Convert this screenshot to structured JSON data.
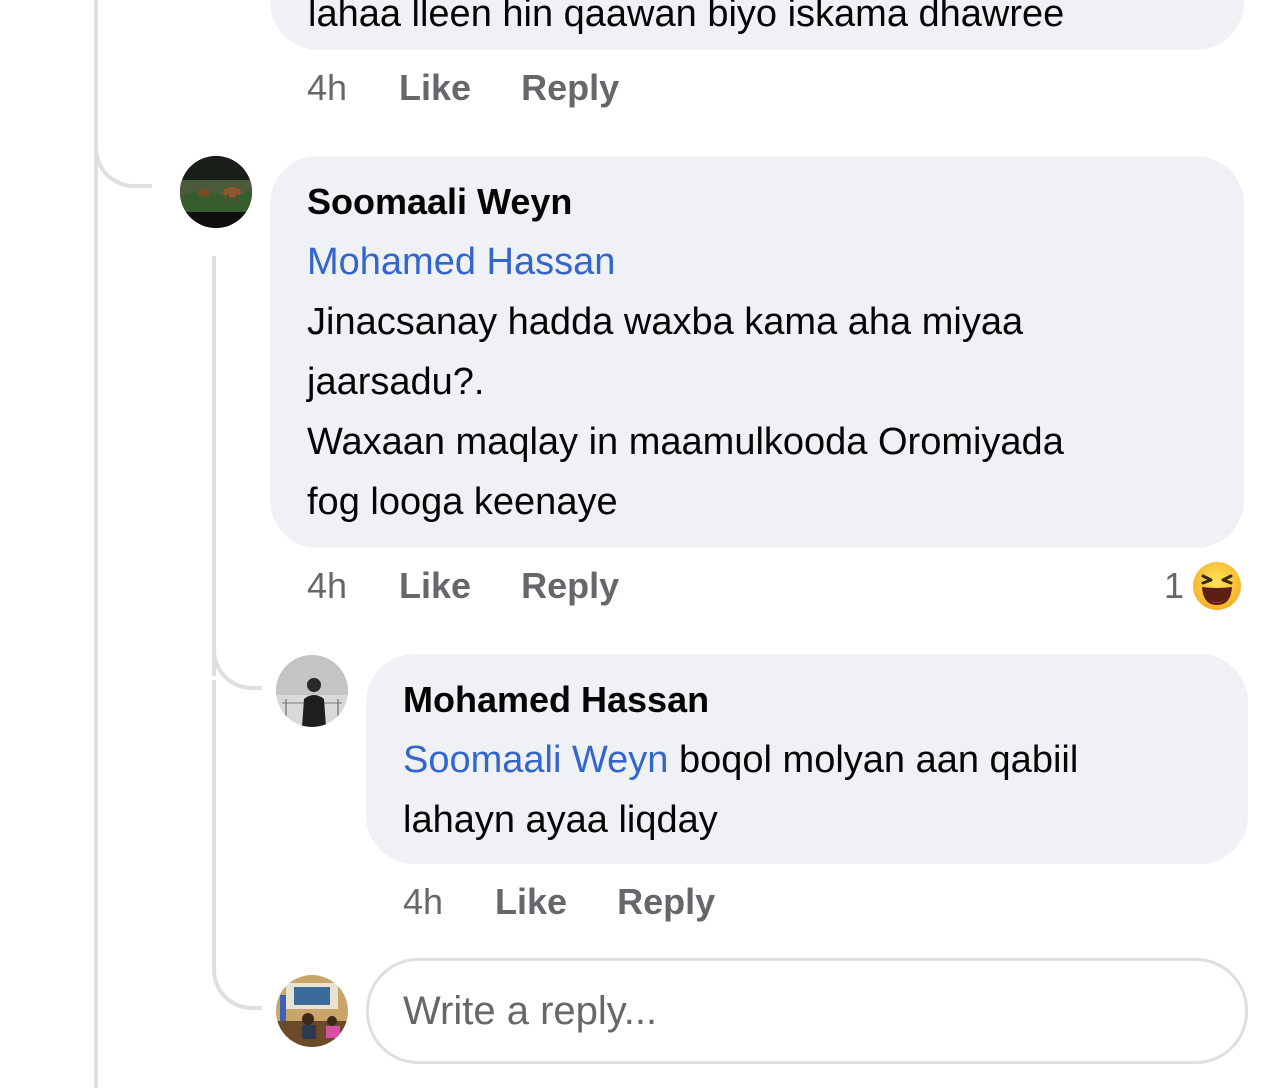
{
  "top_comment": {
    "text_tail": "lahaa lleen hin qaawan biyo iskama dhawree",
    "time": "4h",
    "like": "Like",
    "reply": "Reply"
  },
  "comment": {
    "author": "Soomaali Weyn",
    "mention": "Mohamed Hassan",
    "text_line1": "Jinacsanay hadda waxba kama aha miyaa",
    "text_line2": "jaarsadu?.",
    "text_line3": "Waxaan maqlay in maamulkooda Oromiyada",
    "text_line4": "fog looga keenaye",
    "time": "4h",
    "like": "Like",
    "reply": "Reply",
    "reaction_count": "1",
    "reaction_icon": "laughing-emoji"
  },
  "reply_comment": {
    "author": "Mohamed Hassan",
    "mention": "Soomaali Weyn",
    "text_line1": "boqol molyan aan qabiil",
    "text_line2": "lahayn ayaa liqday",
    "time": "4h",
    "like": "Like",
    "reply": "Reply"
  },
  "reply_input": {
    "placeholder": "Write a reply..."
  },
  "colors": {
    "bubble": "#f0f1f4",
    "mention": "#3366cc",
    "meta": "#65676b",
    "thread_line": "#dddfe3"
  }
}
